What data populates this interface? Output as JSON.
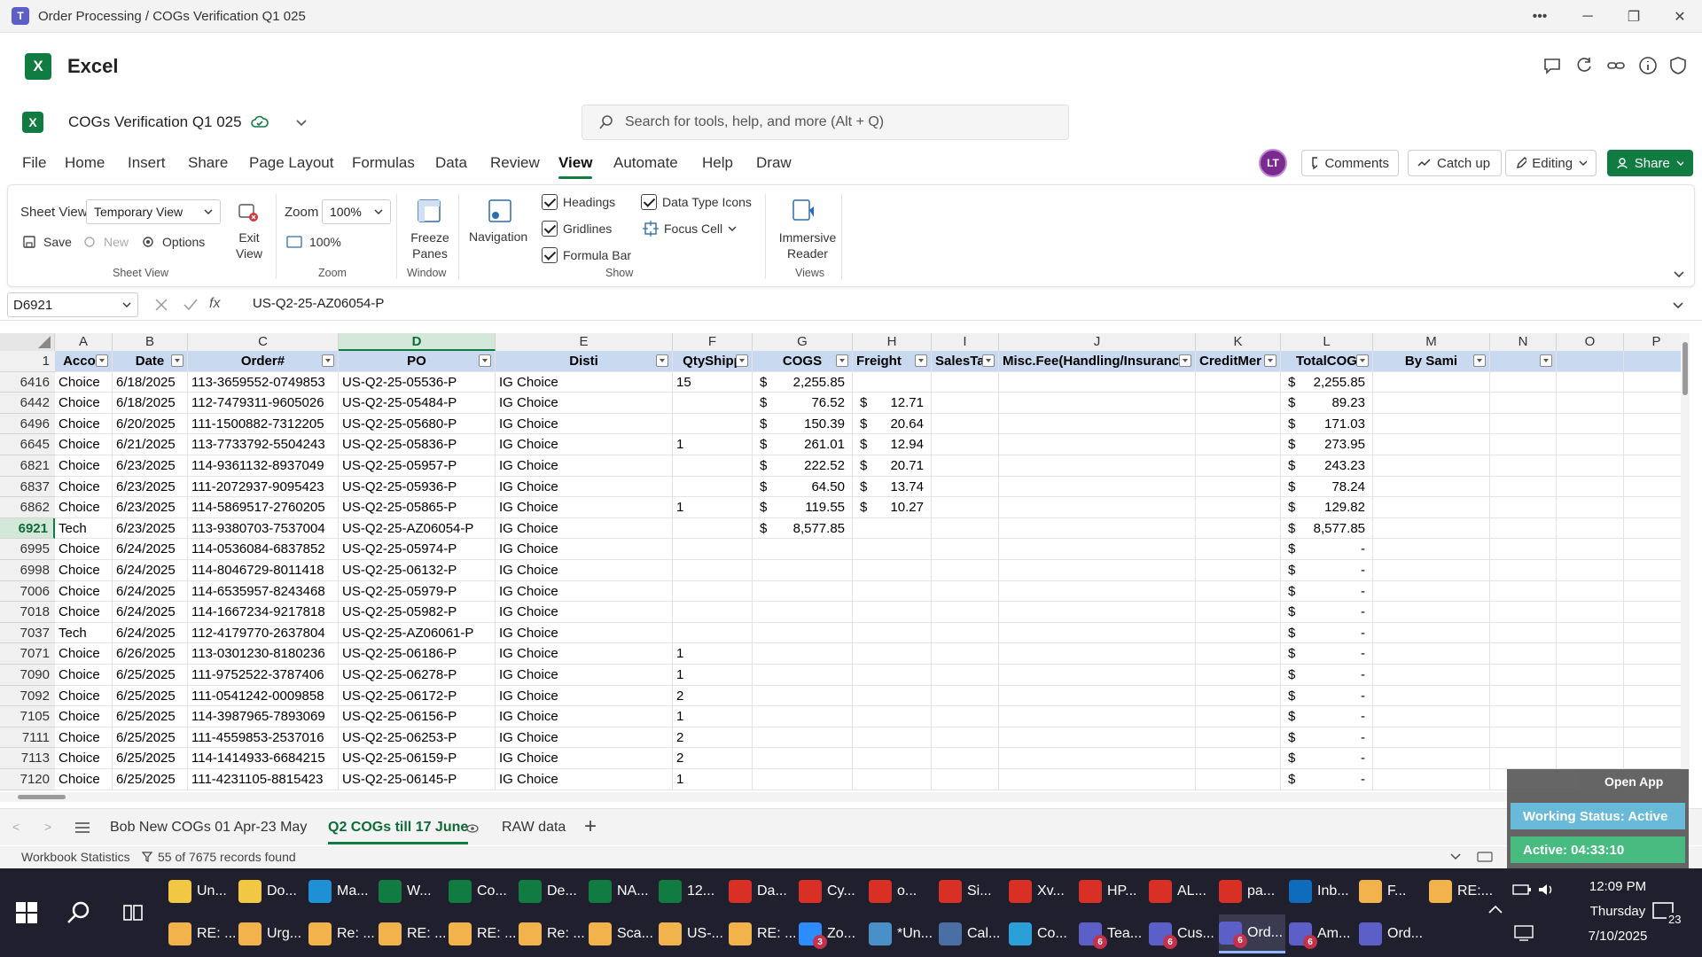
{
  "window": {
    "title": "Order Processing / COGs Verification Q1 025"
  },
  "app": {
    "name": "Excel"
  },
  "doc": {
    "name": "COGs Verification Q1 025"
  },
  "search": {
    "placeholder": "Search for tools, help, and more (Alt + Q)"
  },
  "menu": [
    "File",
    "Home",
    "Insert",
    "Share",
    "Page Layout",
    "Formulas",
    "Data",
    "Review",
    "View",
    "Automate",
    "Help",
    "Draw"
  ],
  "user": {
    "initials": "LT"
  },
  "topbuttons": {
    "comments": "Comments",
    "catchup": "Catch up",
    "editing": "Editing",
    "share": "Share"
  },
  "ribbon": {
    "sheetview_label": "Sheet View",
    "sheetview_value": "Temporary View",
    "save": "Save",
    "new": "New",
    "options": "Options",
    "exit_view": "Exit View",
    "group_sheetview": "Sheet View",
    "zoom_label": "Zoom",
    "zoom_value": "100%",
    "zoom100": "100%",
    "group_zoom": "Zoom",
    "freeze": "Freeze Panes",
    "group_window": "Window",
    "navigation": "Navigation",
    "headings": "Headings",
    "gridlines": "Gridlines",
    "formulabar": "Formula Bar",
    "datatype": "Data Type Icons",
    "focuscell": "Focus Cell",
    "group_show": "Show",
    "immersive": "Immersive Reader",
    "group_views": "Views"
  },
  "formula": {
    "namebox": "D6921",
    "fx": "fx",
    "value": "US-Q2-25-AZ06054-P"
  },
  "columns": [
    "A",
    "B",
    "C",
    "D",
    "E",
    "F",
    "G",
    "H",
    "I",
    "J",
    "K",
    "L",
    "M",
    "N",
    "O",
    "P"
  ],
  "headers": [
    "Accou",
    "Date",
    "Order#",
    "PO",
    "Disti",
    "QtyShipp",
    "COGS",
    "Freight",
    "SalesTa",
    "Misc.Fee(Handling/Insuranc",
    "CreditMer",
    "TotalCOG",
    "By Sami",
    "",
    "",
    ""
  ],
  "header_row_num": "1",
  "rows": [
    {
      "n": "6416",
      "a": "Choice",
      "b": "6/18/2025",
      "c": "113-3659552-0749853",
      "d": "US-Q2-25-05536-P",
      "e": "IG Choice",
      "f": "15",
      "g": "2,255.85",
      "h": "",
      "l": "2,255.85"
    },
    {
      "n": "6442",
      "a": "Choice",
      "b": "6/18/2025",
      "c": "112-7479311-9605026",
      "d": "US-Q2-25-05484-P",
      "e": "IG Choice",
      "f": "",
      "g": "76.52",
      "h": "12.71",
      "l": "89.23"
    },
    {
      "n": "6496",
      "a": "Choice",
      "b": "6/20/2025",
      "c": "111-1500882-7312205",
      "d": "US-Q2-25-05680-P",
      "e": "IG Choice",
      "f": "",
      "g": "150.39",
      "h": "20.64",
      "l": "171.03"
    },
    {
      "n": "6645",
      "a": "Choice",
      "b": "6/21/2025",
      "c": "113-7733792-5504243",
      "d": "US-Q2-25-05836-P",
      "e": "IG Choice",
      "f": "1",
      "g": "261.01",
      "h": "12.94",
      "l": "273.95"
    },
    {
      "n": "6821",
      "a": "Choice",
      "b": "6/23/2025",
      "c": "114-9361132-8937049",
      "d": "US-Q2-25-05957-P",
      "e": "IG Choice",
      "f": "",
      "g": "222.52",
      "h": "20.71",
      "l": "243.23"
    },
    {
      "n": "6837",
      "a": "Choice",
      "b": "6/23/2025",
      "c": "111-2072937-9095423",
      "d": "US-Q2-25-05936-P",
      "e": "IG Choice",
      "f": "",
      "g": "64.50",
      "h": "13.74",
      "l": "78.24"
    },
    {
      "n": "6862",
      "a": "Choice",
      "b": "6/23/2025",
      "c": "114-5869517-2760205",
      "d": "US-Q2-25-05865-P",
      "e": "IG Choice",
      "f": "1",
      "g": "119.55",
      "h": "10.27",
      "l": "129.82"
    },
    {
      "n": "6921",
      "a": "Tech",
      "b": "6/23/2025",
      "c": "113-9380703-7537004",
      "d": "US-Q2-25-AZ06054-P",
      "e": "IG Choice",
      "f": "",
      "g": "8,577.85",
      "h": "",
      "l": "8,577.85"
    },
    {
      "n": "6995",
      "a": "Choice",
      "b": "6/24/2025",
      "c": "114-0536084-6837852",
      "d": "US-Q2-25-05974-P",
      "e": "IG Choice",
      "f": "",
      "g": "",
      "h": "",
      "l": "-"
    },
    {
      "n": "6998",
      "a": "Choice",
      "b": "6/24/2025",
      "c": "114-8046729-8011418",
      "d": "US-Q2-25-06132-P",
      "e": "IG Choice",
      "f": "",
      "g": "",
      "h": "",
      "l": "-"
    },
    {
      "n": "7006",
      "a": "Choice",
      "b": "6/24/2025",
      "c": "114-6535957-8243468",
      "d": "US-Q2-25-05979-P",
      "e": "IG Choice",
      "f": "",
      "g": "",
      "h": "",
      "l": "-"
    },
    {
      "n": "7018",
      "a": "Choice",
      "b": "6/24/2025",
      "c": "114-1667234-9217818",
      "d": "US-Q2-25-05982-P",
      "e": "IG Choice",
      "f": "",
      "g": "",
      "h": "",
      "l": "-"
    },
    {
      "n": "7037",
      "a": "Tech",
      "b": "6/24/2025",
      "c": "112-4179770-2637804",
      "d": "US-Q2-25-AZ06061-P",
      "e": "IG Choice",
      "f": "",
      "g": "",
      "h": "",
      "l": "-"
    },
    {
      "n": "7071",
      "a": "Choice",
      "b": "6/26/2025",
      "c": "113-0301230-8180236",
      "d": "US-Q2-25-06186-P",
      "e": "IG Choice",
      "f": "1",
      "g": "",
      "h": "",
      "l": "-"
    },
    {
      "n": "7090",
      "a": "Choice",
      "b": "6/25/2025",
      "c": "111-9752522-3787406",
      "d": "US-Q2-25-06278-P",
      "e": "IG Choice",
      "f": "1",
      "g": "",
      "h": "",
      "l": "-"
    },
    {
      "n": "7092",
      "a": "Choice",
      "b": "6/25/2025",
      "c": "111-0541242-0009858",
      "d": "US-Q2-25-06172-P",
      "e": "IG Choice",
      "f": "2",
      "g": "",
      "h": "",
      "l": "-"
    },
    {
      "n": "7105",
      "a": "Choice",
      "b": "6/25/2025",
      "c": "114-3987965-7893069",
      "d": "US-Q2-25-06156-P",
      "e": "IG Choice",
      "f": "1",
      "g": "",
      "h": "",
      "l": "-"
    },
    {
      "n": "7111",
      "a": "Choice",
      "b": "6/25/2025",
      "c": "111-4559853-2537016",
      "d": "US-Q2-25-06253-P",
      "e": "IG Choice",
      "f": "2",
      "g": "",
      "h": "",
      "l": "-"
    },
    {
      "n": "7113",
      "a": "Choice",
      "b": "6/25/2025",
      "c": "114-1414933-6684215",
      "d": "US-Q2-25-06159-P",
      "e": "IG Choice",
      "f": "2",
      "g": "",
      "h": "",
      "l": "-"
    },
    {
      "n": "7120",
      "a": "Choice",
      "b": "6/25/2025",
      "c": "111-4231105-8815423",
      "d": "US-Q2-25-06145-P",
      "e": "IG Choice",
      "f": "1",
      "g": "",
      "h": "",
      "l": "-"
    }
  ],
  "currency": "$",
  "sheets": [
    "Bob New COGs 01 Apr-23 May",
    "Q2 COGs till 17 June",
    "RAW data"
  ],
  "status": {
    "stats": "Workbook Statistics",
    "filter": "55 of 7675 records found"
  },
  "floating": {
    "open_app": "Open App",
    "working": "Working Status: Active",
    "active": "Active: 04:33:10"
  },
  "taskbar": {
    "row1": [
      {
        "label": "Un...",
        "color": "#f2c744"
      },
      {
        "label": "Do...",
        "color": "#f2c744"
      },
      {
        "label": "Ma...",
        "color": "#1e90d6"
      },
      {
        "label": "W...",
        "color": "#107c41"
      },
      {
        "label": "Co...",
        "color": "#107c41"
      },
      {
        "label": "De...",
        "color": "#107c41"
      },
      {
        "label": "NA...",
        "color": "#107c41"
      },
      {
        "label": "12...",
        "color": "#107c41"
      },
      {
        "label": "Da...",
        "color": "#d93025"
      },
      {
        "label": "Cy...",
        "color": "#d93025"
      },
      {
        "label": "o...",
        "color": "#d93025"
      },
      {
        "label": "Si...",
        "color": "#d93025"
      },
      {
        "label": "Xv...",
        "color": "#d93025"
      },
      {
        "label": "HP...",
        "color": "#d93025"
      },
      {
        "label": "AL...",
        "color": "#d93025"
      },
      {
        "label": "pa...",
        "color": "#d93025"
      },
      {
        "label": "Inb...",
        "color": "#0f6cbd"
      },
      {
        "label": "F...",
        "color": "#f2b24c"
      },
      {
        "label": "RE:...",
        "color": "#f2b24c"
      }
    ],
    "row2": [
      {
        "label": "RE: ...",
        "color": "#f2b24c"
      },
      {
        "label": "Urg...",
        "color": "#f2b24c"
      },
      {
        "label": "Re: ...",
        "color": "#f2b24c"
      },
      {
        "label": "RE: ...",
        "color": "#f2b24c"
      },
      {
        "label": "RE: ...",
        "color": "#f2b24c"
      },
      {
        "label": "Re: ...",
        "color": "#f2b24c"
      },
      {
        "label": "Sca...",
        "color": "#f2b24c"
      },
      {
        "label": "US-...",
        "color": "#f2b24c"
      },
      {
        "label": "RE: ...",
        "color": "#f2b24c"
      },
      {
        "label": "Zo...",
        "color": "#2d8cff",
        "badge": "3"
      },
      {
        "label": "*Un...",
        "color": "#4a90c8"
      },
      {
        "label": "Cal...",
        "color": "#4a6fa5"
      },
      {
        "label": "Co...",
        "color": "#2b9fd8"
      },
      {
        "label": "Tea...",
        "color": "#5b5fc7",
        "badge": "6"
      },
      {
        "label": "Cus...",
        "color": "#5b5fc7",
        "badge": "6"
      },
      {
        "label": "Ord...",
        "color": "#5b5fc7",
        "badge": "6",
        "active": true
      },
      {
        "label": "Am...",
        "color": "#5b5fc7",
        "badge": "6"
      },
      {
        "label": "Ord...",
        "color": "#5b5fc7"
      }
    ],
    "time": "12:09 PM",
    "day": "Thursday",
    "date": "7/10/2025",
    "notif": "23"
  }
}
